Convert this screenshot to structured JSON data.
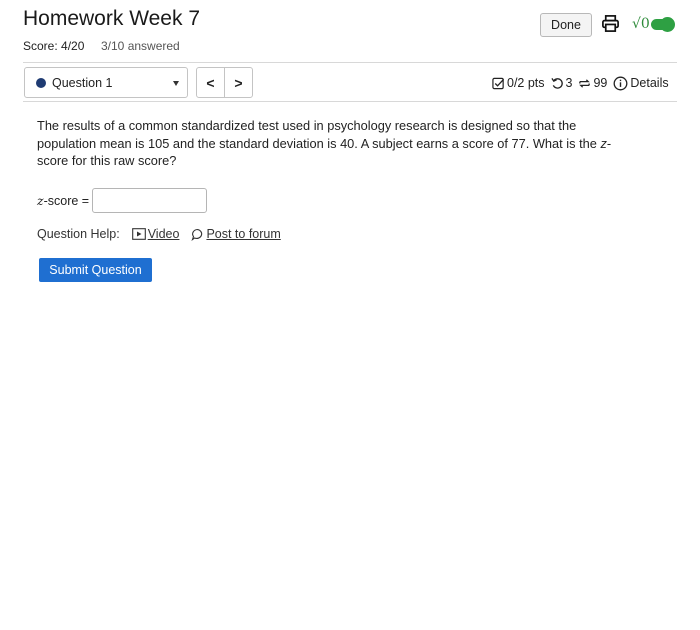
{
  "header": {
    "title": "Homework Week 7",
    "score": "Score: 4/20",
    "answered": "3/10 answered",
    "done_label": "Done",
    "math_toggle": "√0"
  },
  "question_nav": {
    "selected": "Question 1",
    "prev": "<",
    "next": ">"
  },
  "meta": {
    "points": "0/2 pts",
    "attempts": "3",
    "retries": "99",
    "details": "Details"
  },
  "question": {
    "text": "The results of a common standardized test used in psychology research is designed so that the population mean is 105 and the standard deviation is 40. A subject earns a score of 77. What is the",
    "text_tail_var": "z",
    "text_tail": "-score for this raw score?",
    "answer_var": "z",
    "answer_label": "-score =",
    "answer_value": ""
  },
  "help": {
    "label": "Question Help:",
    "video": "Video",
    "forum": "Post to forum"
  },
  "submit_label": "Submit Question",
  "colors": {
    "accent": "#1f6fd1",
    "toggle_green": "#2ea043",
    "dot": "#1f3b73"
  }
}
